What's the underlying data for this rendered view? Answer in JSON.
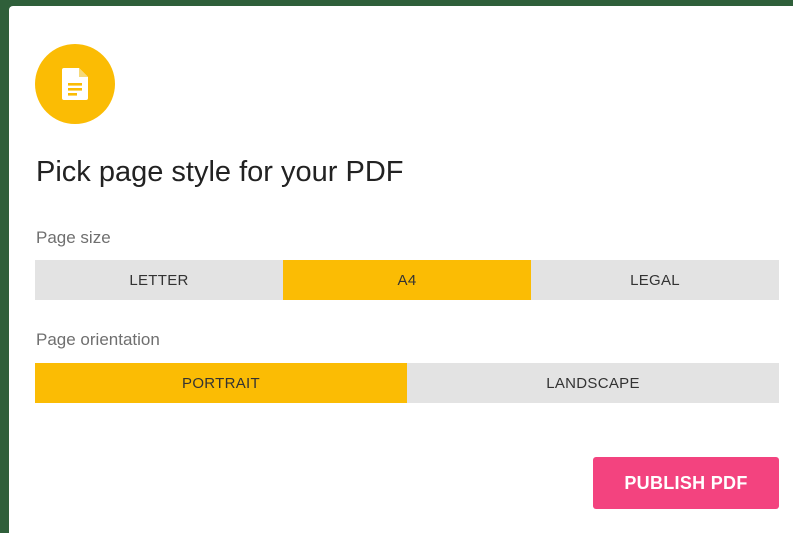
{
  "dialog": {
    "icon": "document-icon",
    "title": "Pick page style for your PDF"
  },
  "page_size": {
    "label": "Page size",
    "options": [
      "LETTER",
      "A4",
      "LEGAL"
    ],
    "selected": "A4"
  },
  "page_orientation": {
    "label": "Page orientation",
    "options": [
      "PORTRAIT",
      "LANDSCAPE"
    ],
    "selected": "PORTRAIT"
  },
  "actions": {
    "publish_label": "PUBLISH PDF"
  },
  "colors": {
    "accent": "#fbbc04",
    "publish": "#f3437f",
    "segment_bg": "#e3e3e3"
  }
}
